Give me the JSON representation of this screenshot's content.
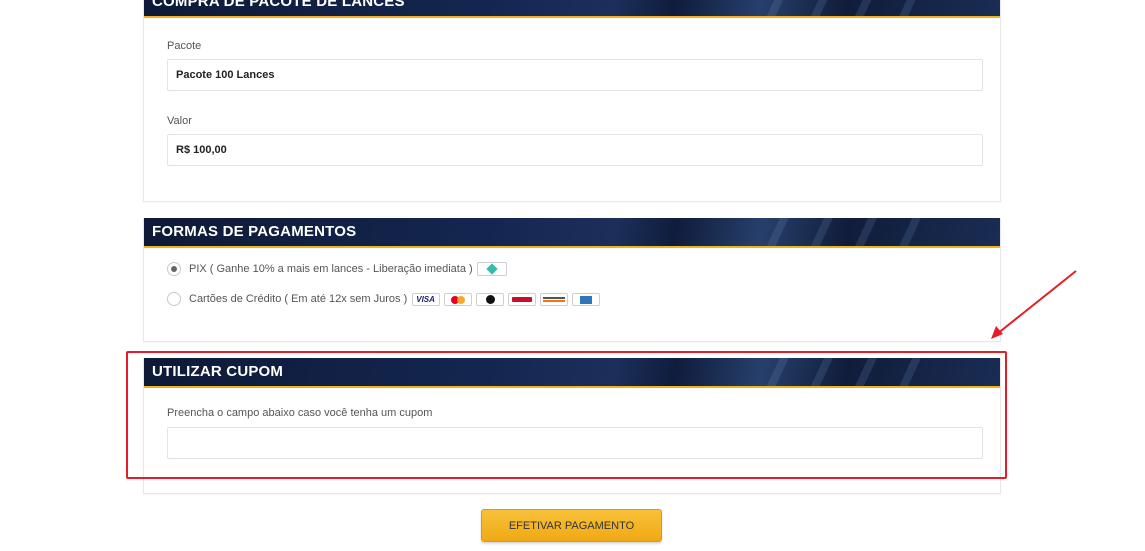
{
  "package_section": {
    "title": "COMPRA DE PACOTE DE LANCES",
    "package_label": "Pacote",
    "package_value": "Pacote 100 Lances",
    "value_label": "Valor",
    "value_value": "R$ 100,00"
  },
  "payment_section": {
    "title": "FORMAS DE PAGAMENTOS",
    "options": [
      {
        "label": "PIX ( Ganhe 10% a mais em lances - Liberação imediata )",
        "selected": true,
        "icons": [
          "pix-icon"
        ]
      },
      {
        "label": "Cartões de Crédito ( Em até 12x sem Juros )",
        "selected": false,
        "icons": [
          "visa-icon",
          "mastercard-icon",
          "elo-icon",
          "hipercard-icon",
          "discover-icon",
          "amex-icon"
        ]
      }
    ]
  },
  "coupon_section": {
    "title": "UTILIZAR CUPOM",
    "instruction": "Preencha o campo abaixo caso você tenha um cupom",
    "coupon_value": ""
  },
  "submit_label": "EFETIVAR PAGAMENTO",
  "colors": {
    "header_bg": "#142650",
    "header_accent": "#f0b21f",
    "button_bg": "#f5b423",
    "annotation": "#e41e26"
  }
}
